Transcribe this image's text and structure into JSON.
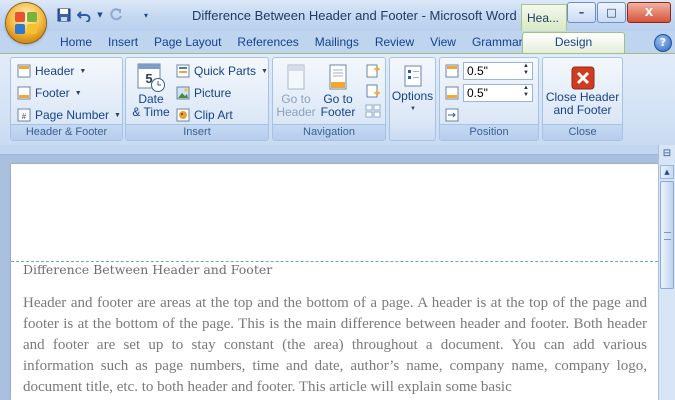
{
  "window": {
    "title": "Difference Between Header and Footer - Microsoft Word",
    "context_tab_title": "Hea...",
    "minimize_glyph": "–",
    "maximize_glyph": "□",
    "close_glyph": "X"
  },
  "tabs": [
    "Home",
    "Insert",
    "Page Layout",
    "References",
    "Mailings",
    "Review",
    "View",
    "Grammarly"
  ],
  "active_tab": "Design",
  "help_glyph": "?",
  "ribbon": {
    "header_footer": {
      "label": "Header & Footer",
      "header": "Header",
      "footer": "Footer",
      "page_number": "Page Number"
    },
    "insert": {
      "label": "Insert",
      "date_time_line1": "Date",
      "date_time_line2": "& Time",
      "quick_parts": "Quick Parts",
      "picture": "Picture",
      "clip_art": "Clip Art"
    },
    "navigation": {
      "label": "Navigation",
      "go_to_header_line1": "Go to",
      "go_to_header_line2": "Header",
      "go_to_footer_line1": "Go to",
      "go_to_footer_line2": "Footer"
    },
    "options": {
      "label": "Options"
    },
    "position": {
      "label": "Position",
      "header_from_top": "0.5\"",
      "footer_from_bottom": "0.5\""
    },
    "close": {
      "label": "Close",
      "close_line1": "Close Header",
      "close_line2": "and Footer"
    }
  },
  "document": {
    "header_text": "Difference Between Header and Footer",
    "body": "Header and footer are areas at the top and the bottom of a page. A header is at the top of the page and footer is at the bottom of the page. This is the main difference between header and footer. Both header and footer are set up to stay constant (the area) throughout a document. You can add various information such as page numbers, time and date, author’s name, company name, company logo, document title, etc. to both header and footer. This article will explain some basic"
  },
  "colors": {
    "accent_green": "#d7e9c2",
    "ribbon_blue": "#d2e2f5",
    "close_red": "#d23b22"
  }
}
